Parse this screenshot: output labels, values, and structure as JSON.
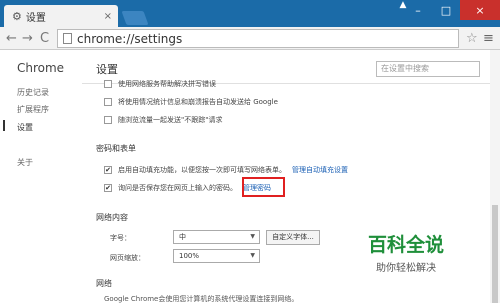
{
  "tab": {
    "title": "设置",
    "close": "×"
  },
  "window": {
    "min": "–",
    "max": "□",
    "close": "×",
    "user": "▲"
  },
  "toolbar": {
    "back": "←",
    "forward": "→",
    "reload": "C",
    "url": "chrome://settings",
    "star": "☆",
    "menu": "≡"
  },
  "sidebar": {
    "brand": "Chrome",
    "items": [
      "历史记录",
      "扩展程序",
      "设置",
      "关于"
    ]
  },
  "main": {
    "title": "设置",
    "search_placeholder": "在设置中搜索",
    "privacy_rows": [
      {
        "text": "使用网络服务帮助解决拼写错误",
        "checked": false
      },
      {
        "text": "将使用情况统计信息和崩溃报告自动发送给 Google",
        "checked": false
      },
      {
        "text": "随浏览流量一起发送\"不跟踪\"请求",
        "checked": false
      }
    ],
    "password_section": "密码和表单",
    "autofill_row": {
      "text": "启用自动填充功能，以便您按一次即可填写网络表单。",
      "link": "管理自动填充设置",
      "checked": true
    },
    "password_row": {
      "text": "询问是否保存您在网页上输入的密码。",
      "link": "管理密码",
      "checked": true
    },
    "web_content_section": "网络内容",
    "font_size_label": "字号：",
    "font_size_value": "中",
    "custom_font_button": "自定义字体...",
    "zoom_label": "网页缩放：",
    "zoom_value": "100%",
    "network_section": "网络",
    "network_text": "Google Chrome会使用您计算机的系统代理设置连接到网络。"
  },
  "watermark": {
    "big": "百科全说",
    "small": "助你轻松解决"
  },
  "colors": {
    "titlebar": "#1b6ba8",
    "highlight": "#e02020",
    "link": "#1a5fb4",
    "watermark": "#1f8f3a"
  }
}
